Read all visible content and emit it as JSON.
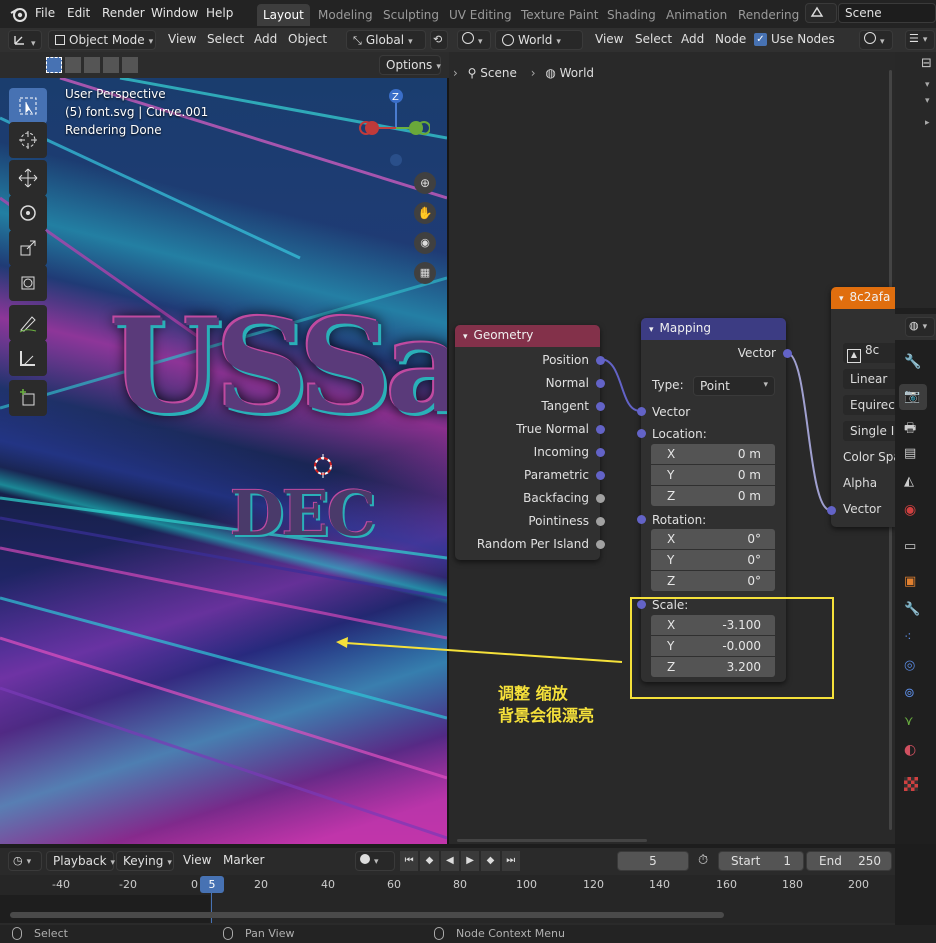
{
  "menubar": {
    "logo_icon": "blender-logo-icon",
    "menus": [
      "File",
      "Edit",
      "Render",
      "Window",
      "Help"
    ],
    "workspaces": [
      "Layout",
      "Modeling",
      "Sculpting",
      "UV Editing",
      "Texture Paint",
      "Shading",
      "Animation",
      "Rendering"
    ],
    "active_workspace": "Layout",
    "scene_label": "Scene"
  },
  "viewport": {
    "mode": "Object Mode",
    "menus": [
      "View",
      "Select",
      "Add",
      "Object"
    ],
    "orientation": "Global",
    "options_label": "Options",
    "perspective": "User Perspective",
    "object_info": "(5) font.svg | Curve.001",
    "status": "Rendering Done",
    "gizmo_z": "Z",
    "scene_text_line1": "USSa",
    "scene_text_line2": "DEC"
  },
  "node_editor": {
    "shader_type": "World",
    "menus": [
      "View",
      "Select",
      "Add",
      "Node"
    ],
    "use_nodes_label": "Use Nodes",
    "use_nodes_checked": true,
    "breadcrumb": [
      "Scene",
      "World"
    ]
  },
  "geometry_node": {
    "title": "Geometry",
    "outputs": [
      "Position",
      "Normal",
      "Tangent",
      "True Normal",
      "Incoming",
      "Parametric",
      "Backfacing",
      "Pointiness",
      "Random Per Island"
    ]
  },
  "mapping_node": {
    "title": "Mapping",
    "output": "Vector",
    "type_label": "Type:",
    "type_value": "Point",
    "input_vector": "Vector",
    "location_label": "Location:",
    "location": [
      {
        "axis": "X",
        "value": "0 m"
      },
      {
        "axis": "Y",
        "value": "0 m"
      },
      {
        "axis": "Z",
        "value": "0 m"
      }
    ],
    "rotation_label": "Rotation:",
    "rotation": [
      {
        "axis": "X",
        "value": "0°"
      },
      {
        "axis": "Y",
        "value": "0°"
      },
      {
        "axis": "Z",
        "value": "0°"
      }
    ],
    "scale_label": "Scale:",
    "scale": [
      {
        "axis": "X",
        "value": "-3.100"
      },
      {
        "axis": "Y",
        "value": "-0.000"
      },
      {
        "axis": "Z",
        "value": "3.200"
      }
    ]
  },
  "image_node": {
    "title": "8c2afa",
    "image_field": "8c",
    "interpolation": "Linear",
    "projection": "Equirect",
    "extension": "Single In",
    "color_space": "Color Spa",
    "alpha": "Alpha",
    "vector": "Vector"
  },
  "annotation": {
    "line1": "调整 缩放",
    "line2": "背景会很漂亮",
    "color": "#f5e13a"
  },
  "timeline": {
    "menus": [
      "Playback",
      "Keying",
      "View",
      "Marker"
    ],
    "current_frame": "5",
    "start_label": "Start",
    "start_value": "1",
    "end_label": "End",
    "end_value": "250",
    "ruler": [
      "-40",
      "-20",
      "0",
      "20",
      "40",
      "60",
      "80",
      "100",
      "120",
      "140",
      "160",
      "180",
      "200"
    ],
    "playhead": "5"
  },
  "statusbar": {
    "items": [
      "Select",
      "Pan View",
      "Node Context Menu"
    ]
  },
  "colors": {
    "accent": "#4772b3",
    "geometry_header": "#83314a",
    "mapping_header": "#3c3c83",
    "texture_header": "#e06e0e",
    "vector_socket": "#6363c7"
  }
}
